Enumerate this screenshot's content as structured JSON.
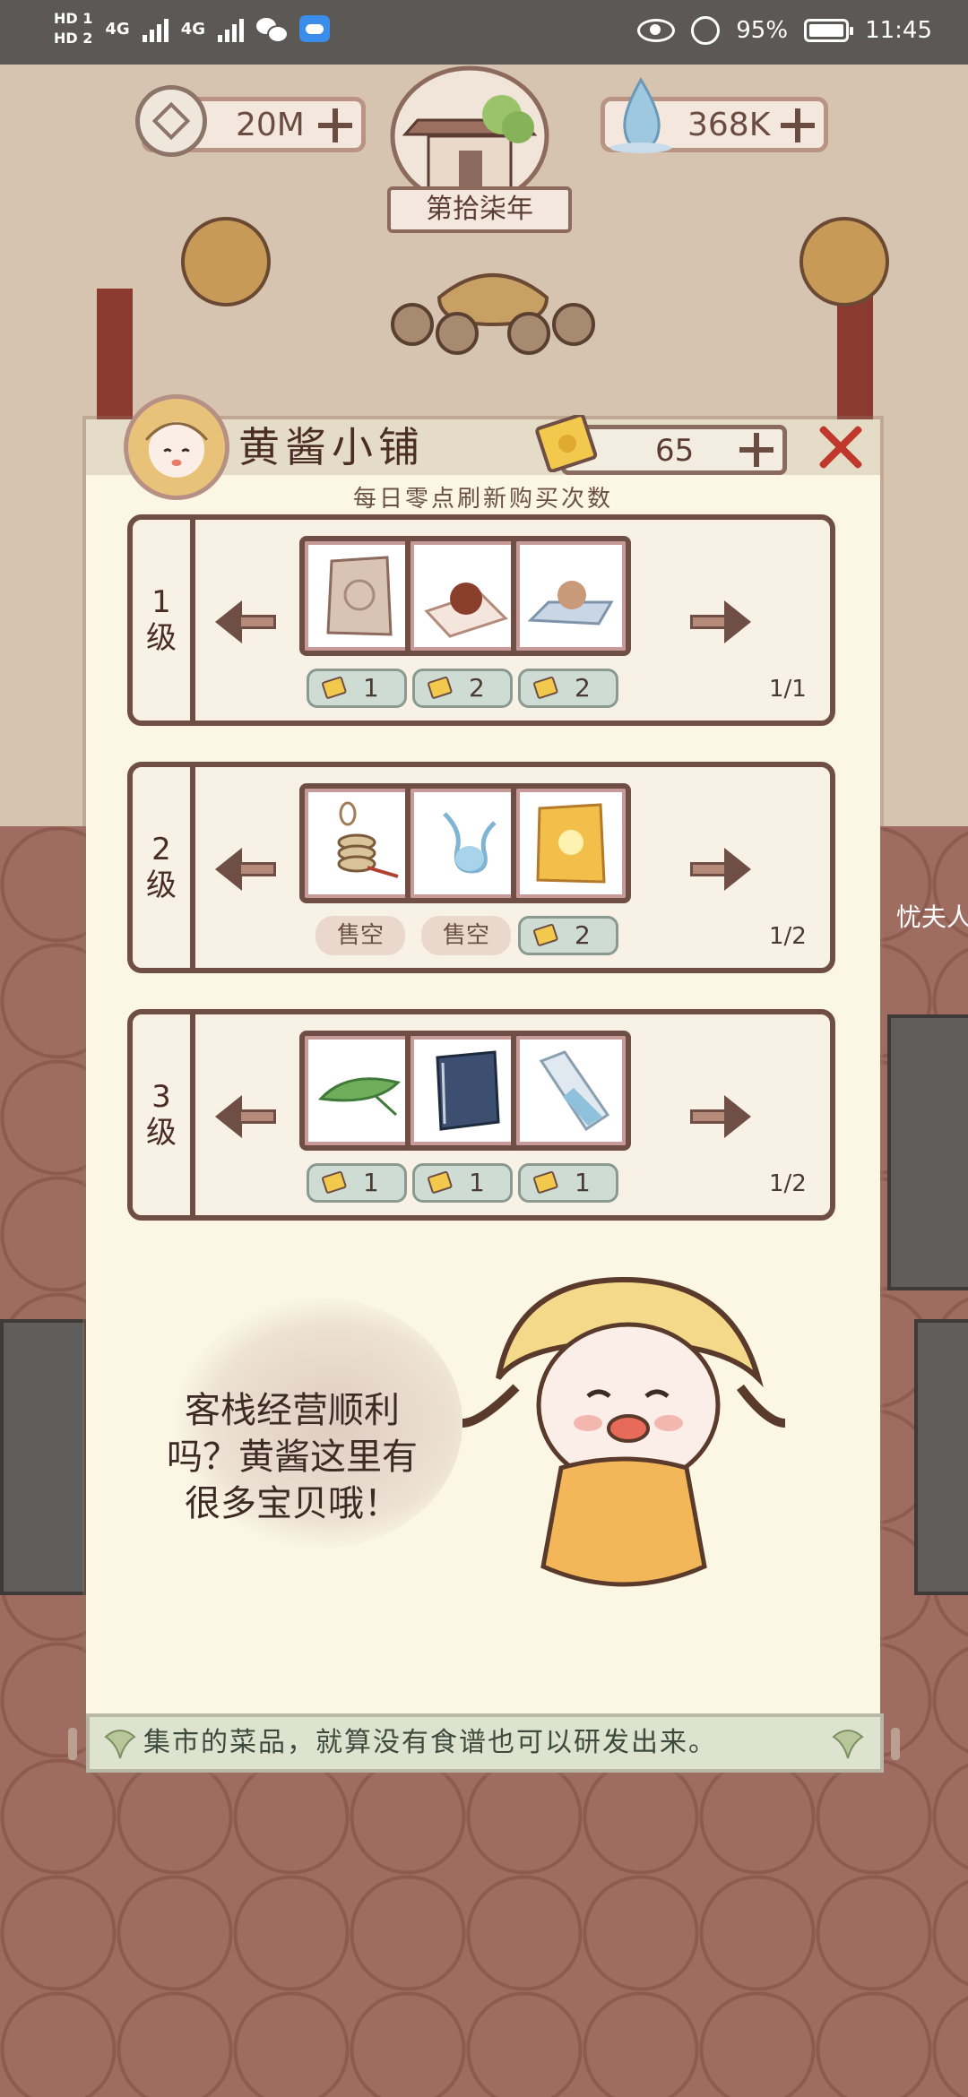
{
  "status_bar": {
    "hd1": "HD 1",
    "hd2": "HD 2",
    "net1": "4G",
    "net2": "4G",
    "battery": "95%",
    "time": "11:45"
  },
  "currencies": {
    "coins": "20M",
    "water": "368K",
    "year": "第拾柒年"
  },
  "shop": {
    "title": "黄酱小铺",
    "tickets": "65",
    "subtitle": "每日零点刷新购买次数"
  },
  "tiers": [
    {
      "level_line1": "1",
      "level_line2": "级",
      "page": "1/1",
      "items": [
        {
          "icon": "seed-packet-icon",
          "price": "1",
          "sold_out": false
        },
        {
          "icon": "red-bean-icon",
          "price": "2",
          "sold_out": false
        },
        {
          "icon": "pearl-on-plate-icon",
          "price": "2",
          "sold_out": false
        }
      ]
    },
    {
      "level_line1": "2",
      "level_line2": "级",
      "page": "1/2",
      "items": [
        {
          "icon": "coin-string-icon",
          "label": "售空",
          "sold_out": true
        },
        {
          "icon": "spirit-water-icon",
          "label": "售空",
          "sold_out": true
        },
        {
          "icon": "gold-packet-icon",
          "price": "2",
          "sold_out": false
        }
      ]
    },
    {
      "level_line1": "3",
      "level_line2": "级",
      "page": "1/2",
      "items": [
        {
          "icon": "tea-leaf-icon",
          "price": "1",
          "sold_out": false
        },
        {
          "icon": "book-icon",
          "price": "1",
          "sold_out": false
        },
        {
          "icon": "glass-bottle-icon",
          "price": "1",
          "sold_out": false
        }
      ]
    }
  ],
  "speech": {
    "line1": "客栈经营顺利",
    "line2": "吗？黄酱这里有",
    "line3": "很多宝贝哦！"
  },
  "footer": {
    "tip": "集市的菜品，就算没有食谱也可以研发出来。"
  },
  "background": {
    "npc_label": "忧夫人"
  },
  "colors": {
    "close": "#c0382c",
    "frame": "#6f4e45",
    "panel": "#fbf7e4"
  }
}
